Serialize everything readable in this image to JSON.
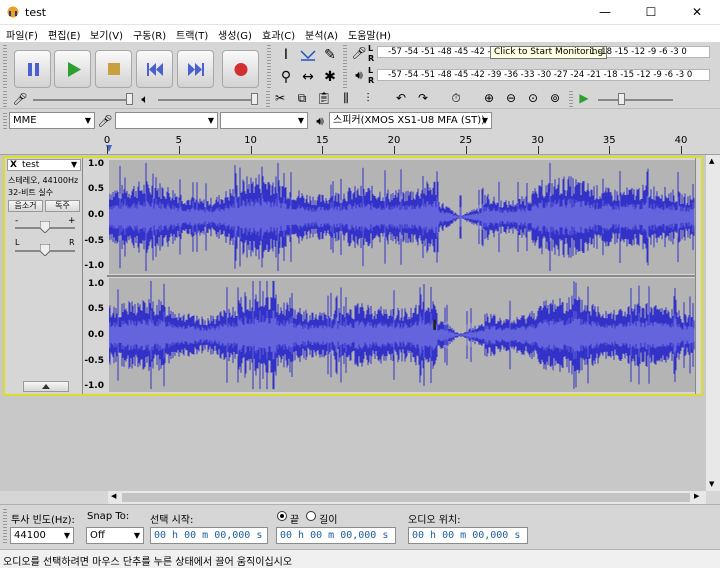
{
  "window": {
    "title": "test"
  },
  "menu": [
    "파일(F)",
    "편집(E)",
    "보기(V)",
    "구동(R)",
    "트랙(T)",
    "생성(G)",
    "효과(C)",
    "분석(A)",
    "도움말(H)"
  ],
  "meters": {
    "record_ticks": "-57 -54 -51 -48 -45 -42 -3",
    "tooltip": "Click to Start Monitoring",
    "record_ticks_right": "1 -18 -15 -12 -9 -6 -3 0",
    "playback_ticks": "-57 -54 -51 -48 -45 -42 -39 -36 -33 -30 -27 -24 -21 -18 -15 -12 -9 -6 -3 0",
    "left_label": "L",
    "right_label": "R"
  },
  "device": {
    "host": "MME",
    "input": "",
    "channels": "",
    "output": "스피커(XMOS XS1-U8 MFA (ST))"
  },
  "ruler": {
    "ticks": [
      "0",
      "5",
      "10",
      "15",
      "20",
      "25",
      "30",
      "35",
      "40"
    ],
    "tick_values": [
      0,
      5,
      10,
      15,
      20,
      25,
      30,
      35,
      40
    ]
  },
  "track": {
    "name": "test",
    "info_line1": "스테레오, 44100Hz",
    "info_line2": "32-비트 실수",
    "mute": "음소거",
    "solo": "독주",
    "gain_minus": "-",
    "gain_plus": "+",
    "pan_left": "L",
    "pan_right": "R",
    "close": "X",
    "vruler": [
      "1.0",
      "0.5",
      "0.0",
      "-0.5",
      "-1.0"
    ]
  },
  "selection_bar": {
    "rate_label": "투사 빈도(Hz):",
    "rate_value": "44100",
    "snap_label": "Snap To:",
    "snap_value": "Off",
    "start_label": "선택 시작:",
    "start_value": "00 h 00 m 00,000 s",
    "end_radio": "끝",
    "length_radio": "길이",
    "end_value": "00 h 00 m 00,000 s",
    "audio_pos_label": "오디오 위치:",
    "audio_pos_value": "00 h 00 m 00,000 s"
  },
  "status": {
    "text": "오디오를 선택하려면 마우스 단추를 누른 상태에서 끌어 움직이십시오"
  },
  "colors": {
    "wave": "#3232c8",
    "wave_rms": "#6464dc",
    "selection_border": "#dcdc2a",
    "play_green": "#2ca02c",
    "record_red": "#d03030",
    "transport_blue": "#4a5fd0"
  }
}
